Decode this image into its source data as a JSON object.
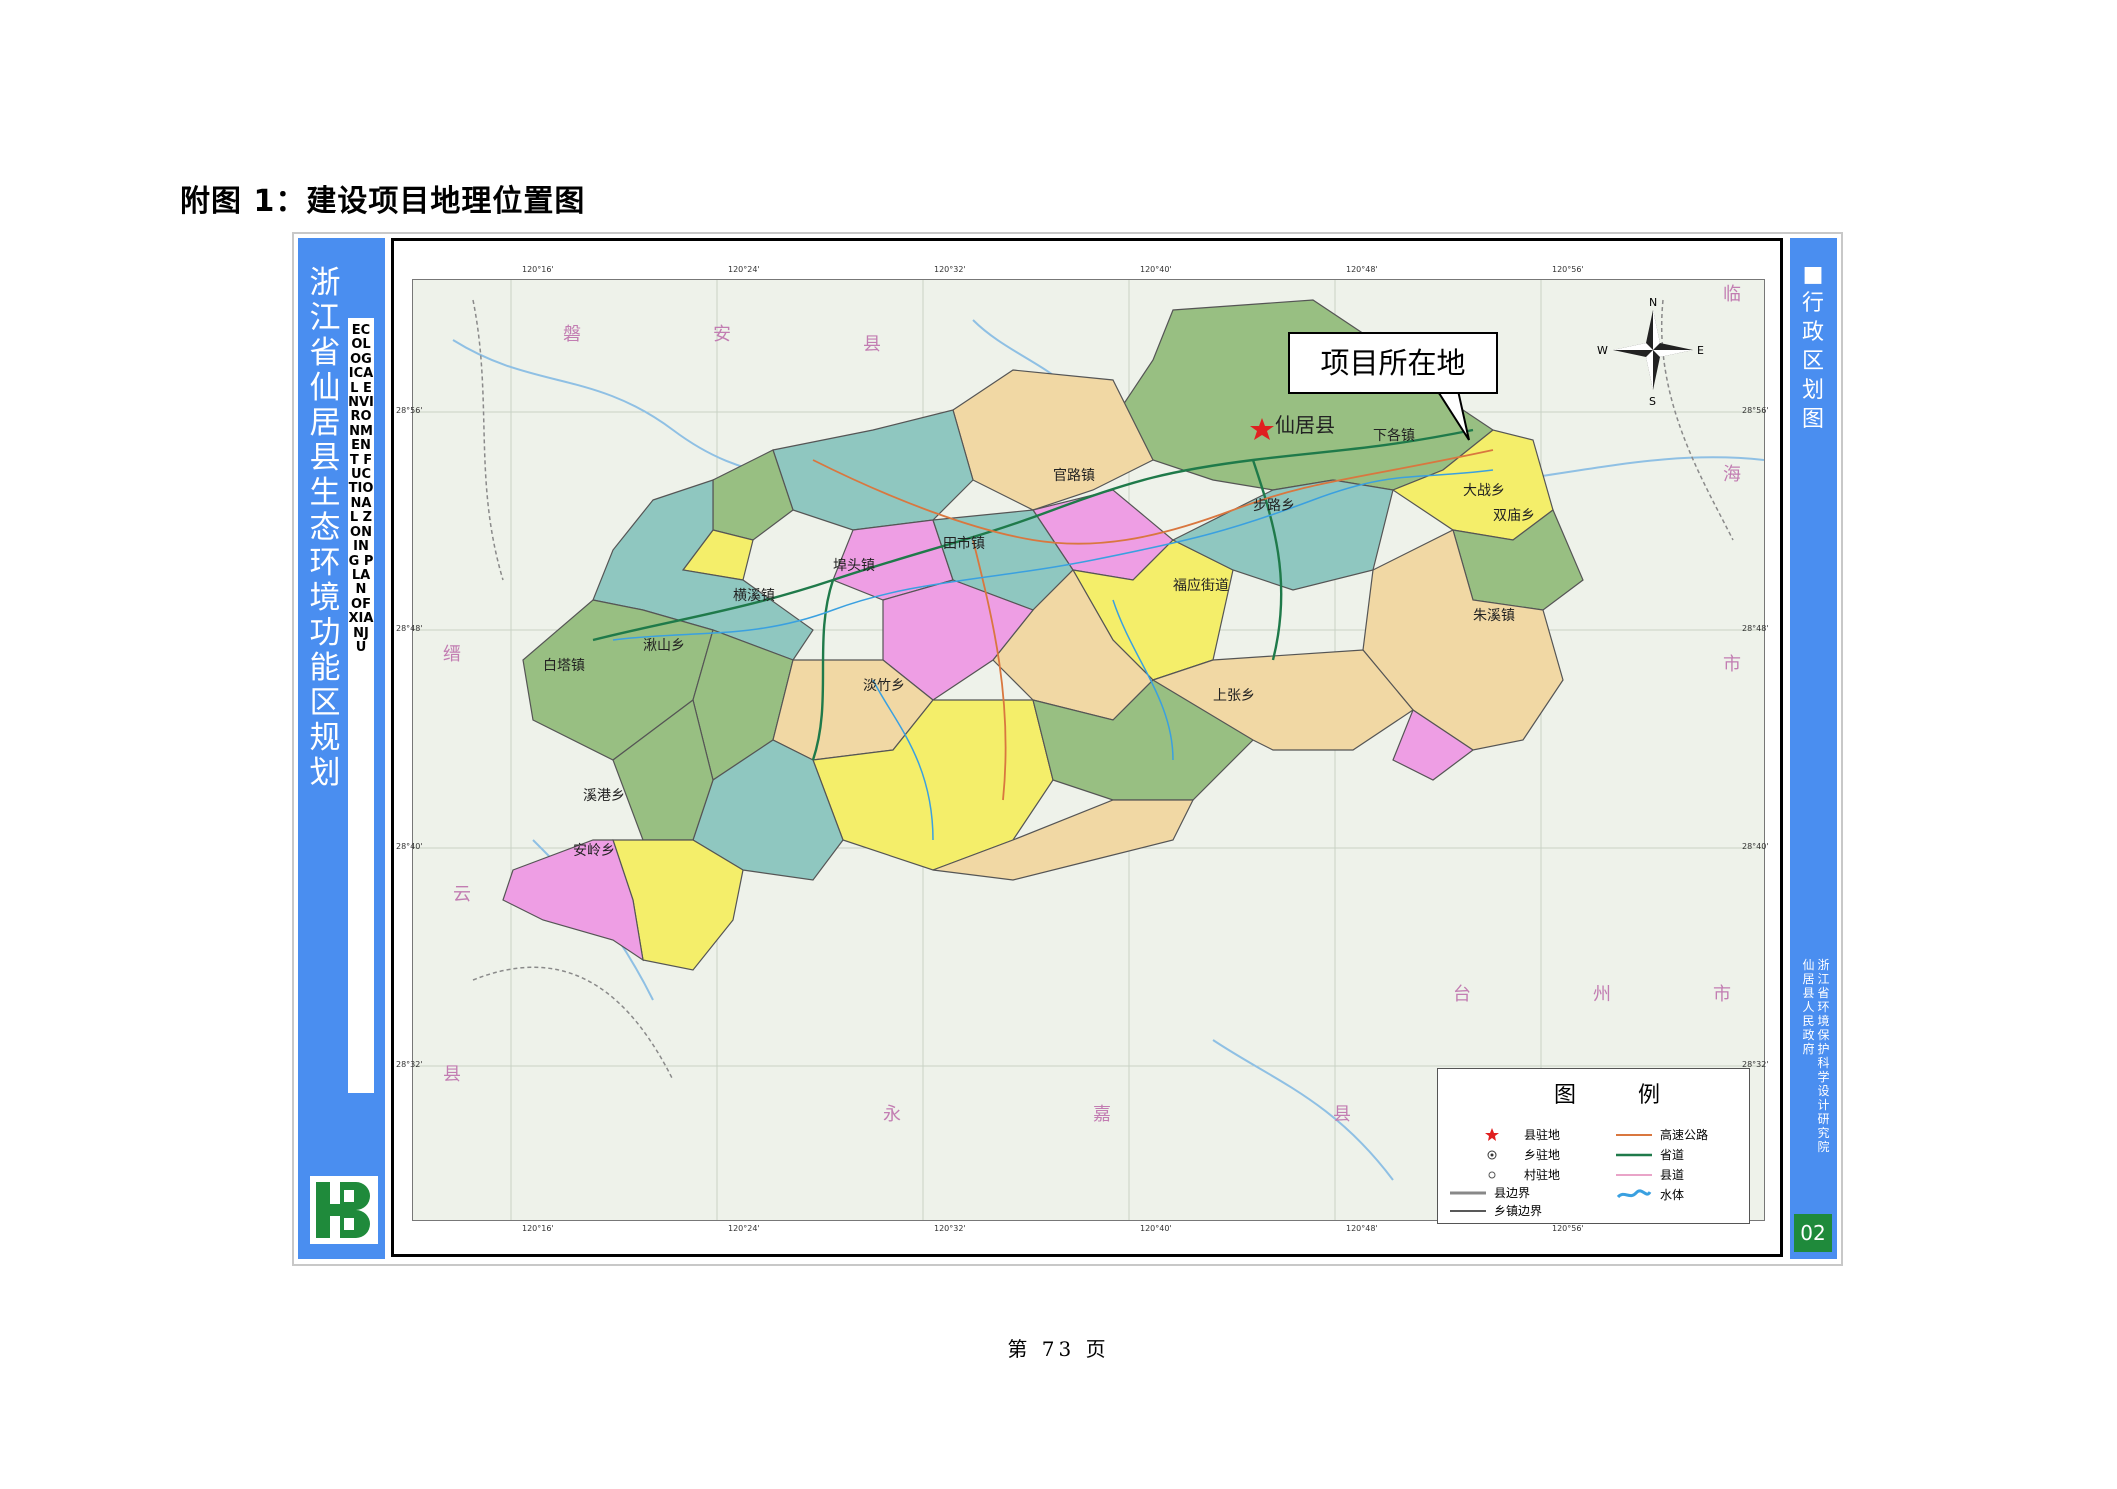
{
  "heading": "附图 1：建设项目地理位置图",
  "left_bar": {
    "title": "浙江省仙居县生态环境功能区规划",
    "english": "ECOLOGICAL ENVIRONMENT FUCTIONAL ZONING PLAN OF XIANJU"
  },
  "right_bar": {
    "title": "行政区划图",
    "org_line1": "浙江省环境保护科学设计研究院",
    "org_line2": "仙居县人民政府",
    "code": "02"
  },
  "callout": "项目所在地",
  "map": {
    "county_seat": "仙居县",
    "longitudes": [
      "120°16'",
      "120°24'",
      "120°32'",
      "120°40'",
      "120°48'",
      "120°56'"
    ],
    "latitudes": [
      "28°56'",
      "28°48'",
      "28°40'",
      "28°32'"
    ],
    "outer_labels": [
      "磐",
      "安",
      "县",
      "缙",
      "云",
      "县",
      "永",
      "嘉",
      "县",
      "台",
      "州",
      "市",
      "临",
      "海",
      "市"
    ],
    "town_labels": [
      "白塔镇",
      "横溪镇",
      "埠头镇",
      "田市镇",
      "安岭乡",
      "淡竹乡",
      "大战乡",
      "朱溪镇",
      "双庙乡",
      "官路镇",
      "下各镇",
      "步路乡",
      "湫山乡",
      "溪港乡",
      "上张乡",
      "福应街道"
    ]
  },
  "legend": {
    "title_a": "图",
    "title_b": "例",
    "items": [
      {
        "label": "县驻地",
        "icon": "red-star"
      },
      {
        "label": "乡驻地",
        "icon": "dotted-circle"
      },
      {
        "label": "村驻地",
        "icon": "small-circle"
      },
      {
        "label": "县边界",
        "icon": "gray-thick-line"
      },
      {
        "label": "乡镇边界",
        "icon": "black-line"
      },
      {
        "label": "高速公路",
        "icon": "orange-line",
        "color": "#d9773f"
      },
      {
        "label": "省道",
        "icon": "green-line",
        "color": "#1f7a4a"
      },
      {
        "label": "县道",
        "icon": "pink-line",
        "color": "#e9a4c8"
      },
      {
        "label": "水体",
        "icon": "water-wave",
        "color": "#3aa0e0"
      }
    ]
  },
  "page_number": "第 73 页",
  "colors": {
    "bar_blue": "#4a8ef0",
    "yellow": "#f4ee6a",
    "pink": "#ee9ee4",
    "teal": "#8fc7c0",
    "green": "#98bf82",
    "peach": "#f1d8a4"
  }
}
